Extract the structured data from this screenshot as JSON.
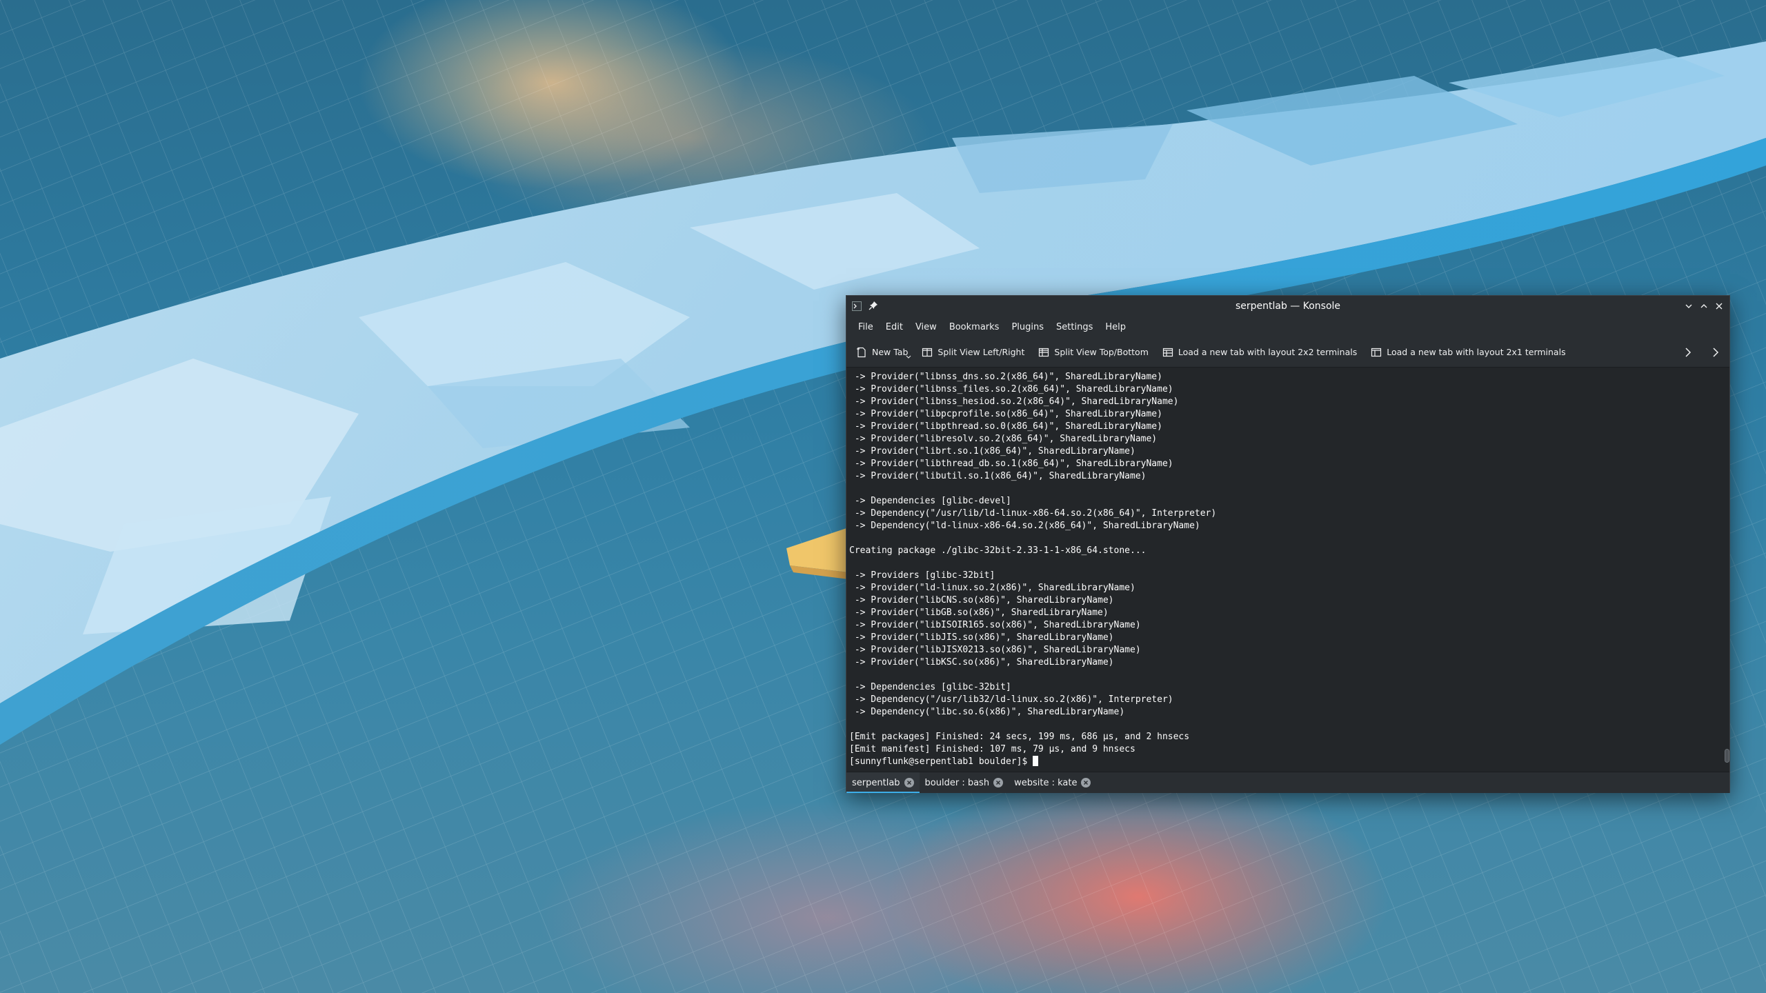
{
  "window": {
    "title": "serpentlab — Konsole",
    "menu": [
      "File",
      "Edit",
      "View",
      "Bookmarks",
      "Plugins",
      "Settings",
      "Help"
    ],
    "toolbar": {
      "new_tab": "New Tab",
      "split_left_right": "Split View Left/Right",
      "split_top_bottom": "Split View Top/Bottom",
      "layout_2x2": "Load a new tab with layout 2x2 terminals",
      "layout_2x1": "Load a new tab with layout 2x1 terminals"
    },
    "terminal_lines": [
      " -> Provider(\"libnss_dns.so.2(x86_64)\", SharedLibraryName)",
      " -> Provider(\"libnss_files.so.2(x86_64)\", SharedLibraryName)",
      " -> Provider(\"libnss_hesiod.so.2(x86_64)\", SharedLibraryName)",
      " -> Provider(\"libpcprofile.so(x86_64)\", SharedLibraryName)",
      " -> Provider(\"libpthread.so.0(x86_64)\", SharedLibraryName)",
      " -> Provider(\"libresolv.so.2(x86_64)\", SharedLibraryName)",
      " -> Provider(\"librt.so.1(x86_64)\", SharedLibraryName)",
      " -> Provider(\"libthread_db.so.1(x86_64)\", SharedLibraryName)",
      " -> Provider(\"libutil.so.1(x86_64)\", SharedLibraryName)",
      "",
      " -> Dependencies [glibc-devel]",
      " -> Dependency(\"/usr/lib/ld-linux-x86-64.so.2(x86_64)\", Interpreter)",
      " -> Dependency(\"ld-linux-x86-64.so.2(x86_64)\", SharedLibraryName)",
      "",
      "Creating package ./glibc-32bit-2.33-1-1-x86_64.stone...",
      "",
      " -> Providers [glibc-32bit]",
      " -> Provider(\"ld-linux.so.2(x86)\", SharedLibraryName)",
      " -> Provider(\"libCNS.so(x86)\", SharedLibraryName)",
      " -> Provider(\"libGB.so(x86)\", SharedLibraryName)",
      " -> Provider(\"libISOIR165.so(x86)\", SharedLibraryName)",
      " -> Provider(\"libJIS.so(x86)\", SharedLibraryName)",
      " -> Provider(\"libJISX0213.so(x86)\", SharedLibraryName)",
      " -> Provider(\"libKSC.so(x86)\", SharedLibraryName)",
      "",
      " -> Dependencies [glibc-32bit]",
      " -> Dependency(\"/usr/lib32/ld-linux.so.2(x86)\", Interpreter)",
      " -> Dependency(\"libc.so.6(x86)\", SharedLibraryName)",
      "",
      "[Emit packages] Finished: 24 secs, 199 ms, 686 µs, and 2 hnsecs",
      "[Emit manifest] Finished: 107 ms, 79 µs, and 9 hnsecs"
    ],
    "prompt": "[sunnyflunk@serpentlab1 boulder]$ ",
    "tabs": [
      {
        "label": "serpentlab",
        "active": true
      },
      {
        "label": "boulder : bash",
        "active": false
      },
      {
        "label": "website : kate",
        "active": false
      }
    ]
  },
  "colors": {
    "accent": "#3daee9",
    "window_bg": "#232629",
    "titlebar_bg": "#2a2e32"
  }
}
